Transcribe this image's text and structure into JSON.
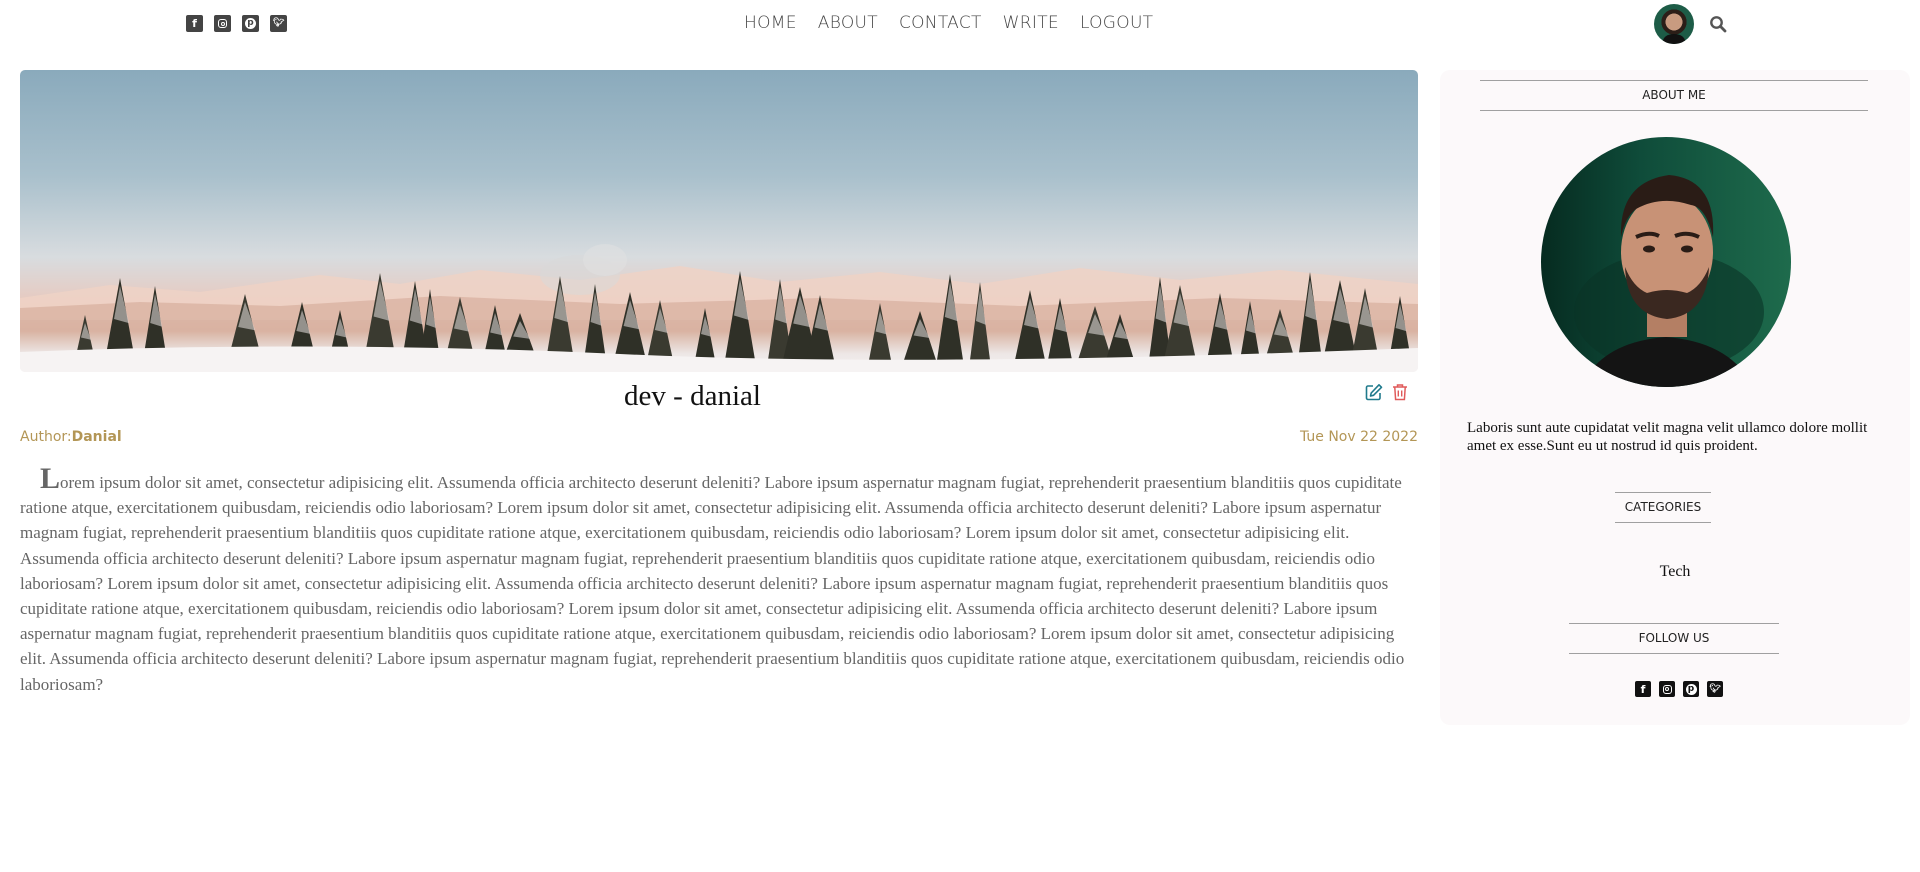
{
  "topbar": {
    "social": [
      {
        "icon": "facebook-square-icon"
      },
      {
        "icon": "instagram-square-icon"
      },
      {
        "icon": "pinterest-square-icon"
      },
      {
        "icon": "twitter-square-icon"
      }
    ],
    "nav": [
      "HOME",
      "ABOUT",
      "CONTACT",
      "WRITE",
      "LOGOUT"
    ],
    "icons": {
      "avatar": "user-avatar",
      "search": "search-icon"
    }
  },
  "post": {
    "title": "dev - danial",
    "author_label": "Author:",
    "author_name": "Danial",
    "date": "Tue Nov 22 2022",
    "dropcap": "L",
    "body": "orem ipsum dolor sit amet, consectetur adipisicing elit. Assumenda officia architecto deserunt deleniti? Labore ipsum aspernatur magnam fugiat, reprehenderit praesentium blanditiis quos cupiditate ratione atque, exercitationem quibusdam, reiciendis odio laboriosam? Lorem ipsum dolor sit amet, consectetur adipisicing elit. Assumenda officia architecto deserunt deleniti? Labore ipsum aspernatur magnam fugiat, reprehenderit praesentium blanditiis quos cupiditate ratione atque, exercitationem quibusdam, reiciendis odio laboriosam? Lorem ipsum dolor sit amet, consectetur adipisicing elit. Assumenda officia architecto deserunt deleniti? Labore ipsum aspernatur magnam fugiat, reprehenderit praesentium blanditiis quos cupiditate ratione atque, exercitationem quibusdam, reiciendis odio laboriosam? Lorem ipsum dolor sit amet, consectetur adipisicing elit. Assumenda officia architecto deserunt deleniti? Labore ipsum aspernatur magnam fugiat, reprehenderit praesentium blanditiis quos cupiditate ratione atque, exercitationem quibusdam, reiciendis odio laboriosam? Lorem ipsum dolor sit amet, consectetur adipisicing elit. Assumenda officia architecto deserunt deleniti? Labore ipsum aspernatur magnam fugiat, reprehenderit praesentium blanditiis quos cupiditate ratione atque, exercitationem quibusdam, reiciendis odio laboriosam? Lorem ipsum dolor sit amet, consectetur adipisicing elit. Assumenda officia architecto deserunt deleniti? Labore ipsum aspernatur magnam fugiat, reprehenderit praesentium blanditiis quos cupiditate ratione atque, exercitationem quibusdam, reiciendis odio laboriosam?",
    "icons": {
      "edit": "edit-icon",
      "delete": "trash-icon"
    },
    "colors": {
      "meta": "#b39656",
      "edit": "#1f7a8c",
      "delete": "#e05a5a"
    }
  },
  "sidebar": {
    "about_title": "ABOUT ME",
    "about_text": "Laboris sunt aute cupidatat velit magna velit ullamco dolore mollit amet ex esse.Sunt eu ut nostrud id quis proident.",
    "categories_title": "CATEGORIES",
    "categories": [
      "Tech"
    ],
    "follow_title": "FOLLOW US",
    "social": [
      {
        "icon": "facebook-square-icon"
      },
      {
        "icon": "instagram-square-icon"
      },
      {
        "icon": "pinterest-square-icon"
      },
      {
        "icon": "twitter-square-icon"
      }
    ]
  }
}
